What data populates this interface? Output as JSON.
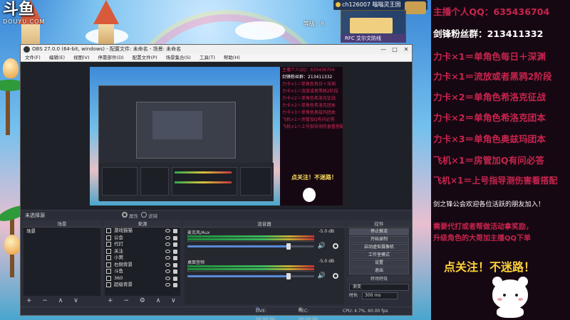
{
  "logo": {
    "main": "斗鱼",
    "sub": "DOUYU.COM"
  },
  "game_hud": {
    "player_name": "ch126007 嗡嗡灵王国",
    "count": "等级：8",
    "panel_label": "RFC 艾尔文防线"
  },
  "obs": {
    "title": "OBS 27.0.0 (64-bit, windows) - 配置文件: 未命名 - 场景: 未命名",
    "window_buttons": [
      "—",
      "□",
      "✕"
    ],
    "menu": [
      "文件(F)",
      "编辑(E)",
      "视图(V)",
      "停靠部件(D)",
      "配置文件(P)",
      "场景集合(S)",
      "工具(T)",
      "帮助(H)"
    ],
    "no_source_label": "未选择源",
    "properties_label": "属性",
    "filters_label": "滤镜",
    "preview_overlay_lines": [
      "主播个人QQ：635436704",
      "剑锋粉丝群：213411332",
      "力卡×1＝单角色每日＋深渊",
      "力卡×1＝流放或者黑鸦2阶段",
      "力卡×2＝单角色希洛克征战",
      "力卡×2＝单角色希洛克团本",
      "力卡×3＝单角色奥兹玛团本",
      "飞机×1＝房管加Q有问必答",
      "飞机×1＝上号指导测伤害看搭配"
    ],
    "preview_follow": "点关注！不迷路！",
    "scenes": {
      "header": "场景",
      "items": [
        "场景"
      ],
      "footer": "+ − ∧ ∨"
    },
    "sources": {
      "header": "来源",
      "items": [
        "游戏猫猫",
        "公会",
        "代打",
        "关注",
        "小窝",
        "右侧背景",
        "斗鱼",
        "360",
        "超级背景"
      ],
      "footer": "+ − ⚙ ∧ ∨"
    },
    "mixer": {
      "header": "混音器",
      "channels": [
        {
          "name": "麦克风/Aux",
          "db": "-5.0 dB",
          "level": 0.8
        },
        {
          "name": "桌面音频",
          "db": "-5.0 dB",
          "level": 0.8
        }
      ]
    },
    "controls": {
      "header": "控件",
      "buttons": [
        "停止推流",
        "开始录制",
        "启动虚拟摄像机",
        "工作室模式",
        "设置",
        "退出"
      ]
    },
    "transitions": {
      "header": "转场特效",
      "selected": "渐变",
      "duration_label": "时长",
      "duration_value": "300 ms"
    },
    "status": {
      "live": "LIVE: 00:00:00",
      "rec": "REC: 00:00:00",
      "cpu": "CPU: 4.7%, 60.00 fps"
    }
  },
  "overlay": {
    "lines": [
      {
        "text": "主播个人QQ：635436704",
        "style": "red"
      },
      {
        "text": "剑锋粉丝群：213411332",
        "style": "white"
      },
      {
        "text": "力卡×1＝单角色每日＋深渊",
        "style": "red"
      },
      {
        "text": "力卡×1＝流放或者黑鸦2阶段",
        "style": "red"
      },
      {
        "text": "力卡×2＝单角色希洛克征战",
        "style": "red"
      },
      {
        "text": "力卡×2＝单角色希洛克团本",
        "style": "red"
      },
      {
        "text": "力卡×3＝单角色奥兹玛团本",
        "style": "red"
      },
      {
        "text": "飞机×1＝房管加Q有问必答",
        "style": "red"
      },
      {
        "text": "飞机×1＝上号指导测伤害看搭配",
        "style": "red"
      }
    ],
    "guild_text": "剑之锋公会欢迎各位活跃的朋友加入！",
    "promo_1": "需要代打或者帮做活动拿奖励，",
    "promo_2": "升级角色的大哥加主播QQ下单",
    "follow": "点关注！不迷路！",
    "colors": {
      "red": "#c8244e",
      "white": "#ffffff",
      "yellow": "#ffd23a",
      "background": "#160812"
    }
  }
}
